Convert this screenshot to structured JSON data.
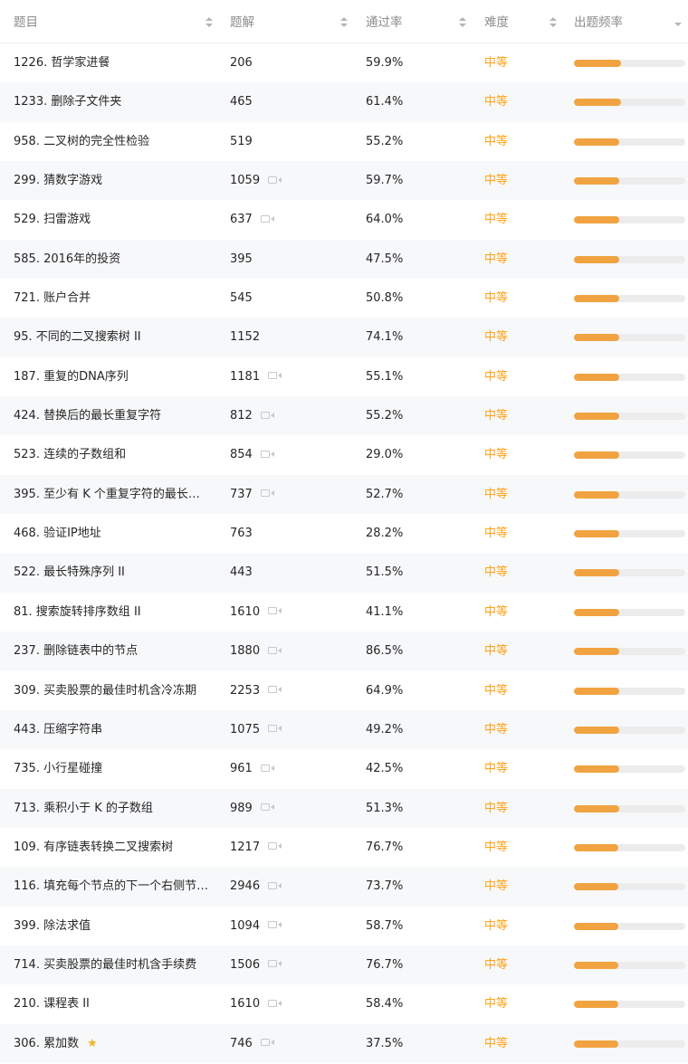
{
  "header": {
    "title": "题目",
    "solutions": "题解",
    "acceptance": "通过率",
    "difficulty": "难度",
    "frequency": "出题频率"
  },
  "colors": {
    "medium": "#ffa116",
    "bar_fill": "#f0a340",
    "bar_track": "#ececec",
    "star": "#f5b325"
  },
  "rows": [
    {
      "title": "1226. 哲学家进餐",
      "solutions": "206",
      "acceptance": "59.9%",
      "difficulty": "中等",
      "video": false,
      "frequency": 0.42
    },
    {
      "title": "1233. 删除子文件夹",
      "solutions": "465",
      "acceptance": "61.4%",
      "difficulty": "中等",
      "video": false,
      "frequency": 0.42
    },
    {
      "title": "958. 二叉树的完全性检验",
      "solutions": "519",
      "acceptance": "55.2%",
      "difficulty": "中等",
      "video": false,
      "frequency": 0.41
    },
    {
      "title": "299. 猜数字游戏",
      "solutions": "1059",
      "acceptance": "59.7%",
      "difficulty": "中等",
      "video": true,
      "frequency": 0.41
    },
    {
      "title": "529. 扫雷游戏",
      "solutions": "637",
      "acceptance": "64.0%",
      "difficulty": "中等",
      "video": true,
      "frequency": 0.41
    },
    {
      "title": "585. 2016年的投资",
      "solutions": "395",
      "acceptance": "47.5%",
      "difficulty": "中等",
      "video": false,
      "frequency": 0.41
    },
    {
      "title": "721. 账户合并",
      "solutions": "545",
      "acceptance": "50.8%",
      "difficulty": "中等",
      "video": false,
      "frequency": 0.41
    },
    {
      "title": "95. 不同的二叉搜索树 II",
      "solutions": "1152",
      "acceptance": "74.1%",
      "difficulty": "中等",
      "video": false,
      "frequency": 0.41
    },
    {
      "title": "187. 重复的DNA序列",
      "solutions": "1181",
      "acceptance": "55.1%",
      "difficulty": "中等",
      "video": true,
      "frequency": 0.41
    },
    {
      "title": "424. 替换后的最长重复字符",
      "solutions": "812",
      "acceptance": "55.2%",
      "difficulty": "中等",
      "video": true,
      "frequency": 0.41
    },
    {
      "title": "523. 连续的子数组和",
      "solutions": "854",
      "acceptance": "29.0%",
      "difficulty": "中等",
      "video": true,
      "frequency": 0.41
    },
    {
      "title": "395. 至少有 K 个重复字符的最长…",
      "solutions": "737",
      "acceptance": "52.7%",
      "difficulty": "中等",
      "video": true,
      "frequency": 0.41
    },
    {
      "title": "468. 验证IP地址",
      "solutions": "763",
      "acceptance": "28.2%",
      "difficulty": "中等",
      "video": false,
      "frequency": 0.41
    },
    {
      "title": "522. 最长特殊序列 II",
      "solutions": "443",
      "acceptance": "51.5%",
      "difficulty": "中等",
      "video": false,
      "frequency": 0.41
    },
    {
      "title": "81. 搜索旋转排序数组 II",
      "solutions": "1610",
      "acceptance": "41.1%",
      "difficulty": "中等",
      "video": true,
      "frequency": 0.41
    },
    {
      "title": "237. 删除链表中的节点",
      "solutions": "1880",
      "acceptance": "86.5%",
      "difficulty": "中等",
      "video": true,
      "frequency": 0.41
    },
    {
      "title": "309. 买卖股票的最佳时机含冷冻期",
      "solutions": "2253",
      "acceptance": "64.9%",
      "difficulty": "中等",
      "video": true,
      "frequency": 0.41
    },
    {
      "title": "443. 压缩字符串",
      "solutions": "1075",
      "acceptance": "49.2%",
      "difficulty": "中等",
      "video": true,
      "frequency": 0.41
    },
    {
      "title": "735. 小行星碰撞",
      "solutions": "961",
      "acceptance": "42.5%",
      "difficulty": "中等",
      "video": true,
      "frequency": 0.41
    },
    {
      "title": "713. 乘积小于 K 的子数组",
      "solutions": "989",
      "acceptance": "51.3%",
      "difficulty": "中等",
      "video": true,
      "frequency": 0.41
    },
    {
      "title": "109. 有序链表转换二叉搜索树",
      "solutions": "1217",
      "acceptance": "76.7%",
      "difficulty": "中等",
      "video": true,
      "frequency": 0.4
    },
    {
      "title": "116. 填充每个节点的下一个右侧节…",
      "solutions": "2946",
      "acceptance": "73.7%",
      "difficulty": "中等",
      "video": true,
      "frequency": 0.4
    },
    {
      "title": "399. 除法求值",
      "solutions": "1094",
      "acceptance": "58.7%",
      "difficulty": "中等",
      "video": true,
      "frequency": 0.4
    },
    {
      "title": "714. 买卖股票的最佳时机含手续费",
      "solutions": "1506",
      "acceptance": "76.7%",
      "difficulty": "中等",
      "video": true,
      "frequency": 0.4
    },
    {
      "title": "210. 课程表 II",
      "solutions": "1610",
      "acceptance": "58.4%",
      "difficulty": "中等",
      "video": true,
      "frequency": 0.4
    },
    {
      "title": "306. 累加数",
      "solutions": "746",
      "acceptance": "37.5%",
      "difficulty": "中等",
      "video": true,
      "star": true,
      "frequency": 0.4
    }
  ]
}
